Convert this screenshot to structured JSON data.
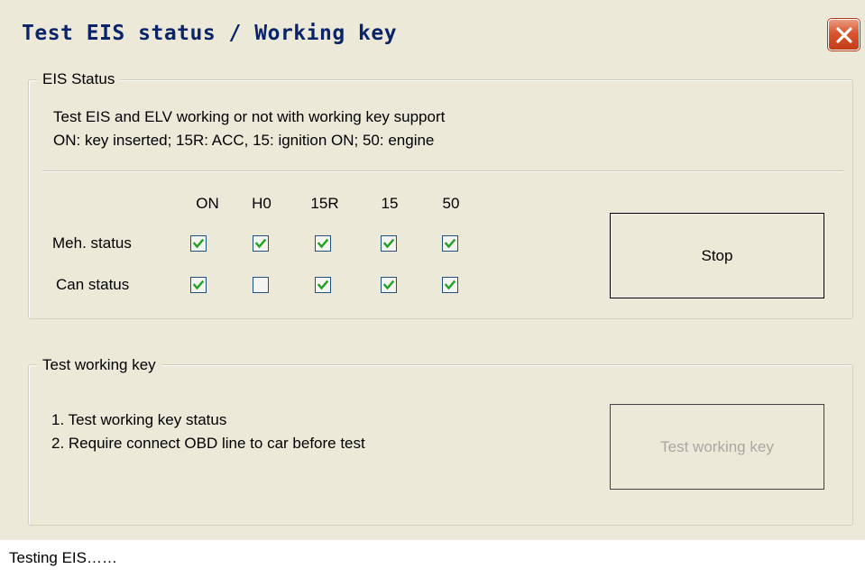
{
  "window": {
    "title": "Test EIS status / Working key"
  },
  "eis_group": {
    "legend": "EIS Status",
    "description_line1": "Test EIS and ELV working or not with working key support",
    "description_line2": "ON: key inserted; 15R: ACC, 15: ignition ON; 50: engine",
    "columns": [
      "ON",
      "H0",
      "15R",
      "15",
      "50"
    ],
    "rows": [
      {
        "label": "Meh. status",
        "checked": [
          true,
          true,
          true,
          true,
          true
        ]
      },
      {
        "label": "Can status",
        "checked": [
          true,
          false,
          true,
          true,
          true
        ]
      }
    ],
    "stop_button": "Stop"
  },
  "key_group": {
    "legend": "Test working key",
    "step1": "1. Test working key status",
    "step2": "2. Require connect OBD line to car before test",
    "test_button": "Test working key"
  },
  "status_bar": {
    "text": "Testing EIS……"
  },
  "colors": {
    "title_text": "#0a246a",
    "check_mark": "#21a121",
    "close_button": "#d8562f"
  }
}
